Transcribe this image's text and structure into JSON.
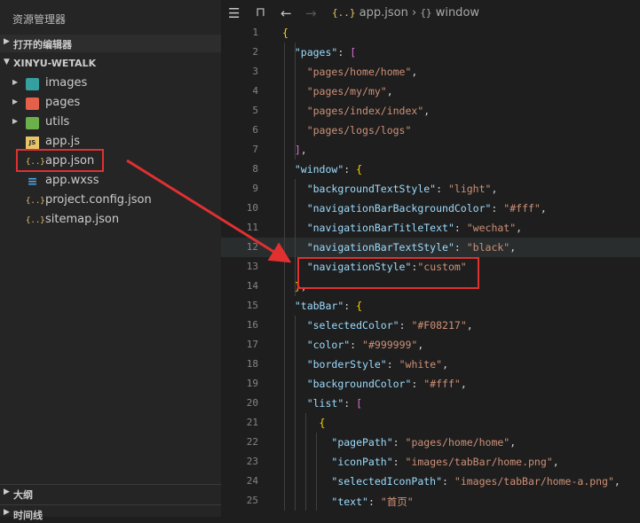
{
  "sidebar": {
    "title": "资源管理器",
    "open_editors": "打开的编辑器",
    "workspace": "XINYU-WETALK",
    "items": [
      {
        "label": "images",
        "icon": "images-folder-icon",
        "type": "folder"
      },
      {
        "label": "pages",
        "icon": "pages-folder-icon",
        "type": "folder"
      },
      {
        "label": "utils",
        "icon": "utils-folder-icon",
        "type": "folder"
      },
      {
        "label": "app.js",
        "icon": "js-file-icon",
        "icon_text": "JS",
        "type": "file"
      },
      {
        "label": "app.json",
        "icon": "json-file-icon",
        "icon_text": "{..}",
        "type": "file"
      },
      {
        "label": "app.wxss",
        "icon": "css-file-icon",
        "icon_text": "≡",
        "type": "file"
      },
      {
        "label": "project.config.json",
        "icon": "json-file-icon",
        "icon_text": "{..}",
        "type": "file"
      },
      {
        "label": "sitemap.json",
        "icon": "json-file-icon",
        "icon_text": "{..}",
        "type": "file"
      }
    ],
    "outline": "大纲",
    "timeline": "时间线"
  },
  "editor": {
    "breadcrumb": {
      "file_icon": "{..}",
      "file": "app.json",
      "separator": "›",
      "symbol_icon": "{}",
      "symbol": "window"
    }
  },
  "code_lines": [
    {
      "n": "1",
      "t": "{"
    },
    {
      "n": "2",
      "t": "  \"pages\": ["
    },
    {
      "n": "3",
      "t": "    \"pages/home/home\","
    },
    {
      "n": "4",
      "t": "    \"pages/my/my\","
    },
    {
      "n": "5",
      "t": "    \"pages/index/index\","
    },
    {
      "n": "6",
      "t": "    \"pages/logs/logs\""
    },
    {
      "n": "7",
      "t": "  ],"
    },
    {
      "n": "8",
      "t": "  \"window\": {"
    },
    {
      "n": "9",
      "t": "    \"backgroundTextStyle\": \"light\","
    },
    {
      "n": "10",
      "t": "    \"navigationBarBackgroundColor\": \"#fff\","
    },
    {
      "n": "11",
      "t": "    \"navigationBarTitleText\": \"wechat\","
    },
    {
      "n": "12",
      "t": "    \"navigationBarTextStyle\": \"black\","
    },
    {
      "n": "13",
      "t": "    \"navigationStyle\":\"custom\""
    },
    {
      "n": "14",
      "t": "  },"
    },
    {
      "n": "15",
      "t": "  \"tabBar\": {"
    },
    {
      "n": "16",
      "t": "    \"selectedColor\": \"#F08217\","
    },
    {
      "n": "17",
      "t": "    \"color\": \"#999999\","
    },
    {
      "n": "18",
      "t": "    \"borderStyle\": \"white\","
    },
    {
      "n": "19",
      "t": "    \"backgroundColor\": \"#fff\","
    },
    {
      "n": "20",
      "t": "    \"list\": ["
    },
    {
      "n": "21",
      "t": "      {"
    },
    {
      "n": "22",
      "t": "        \"pagePath\": \"pages/home/home\","
    },
    {
      "n": "23",
      "t": "        \"iconPath\": \"images/tabBar/home.png\","
    },
    {
      "n": "24",
      "t": "        \"selectedIconPath\": \"images/tabBar/home-a.png\","
    },
    {
      "n": "25",
      "t": "        \"text\": \"首页\""
    }
  ],
  "colors": {
    "annotation": "#e03030",
    "key": "#9cdcfe",
    "string": "#ce9178",
    "bracket_gold": "#ffd700",
    "bracket_purple": "#da70d6",
    "bracket_blue": "#179fff"
  }
}
